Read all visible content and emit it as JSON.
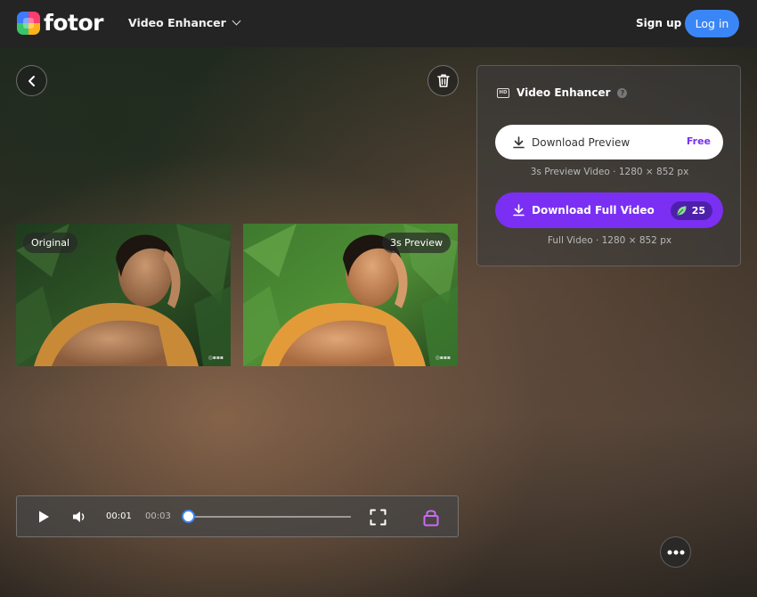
{
  "header": {
    "brand": "fotor",
    "nav_item": "Video Enhancer",
    "signup_label": "Sign up",
    "login_label": "Log in"
  },
  "previews": {
    "original_label": "Original",
    "enhanced_label": "3s Preview"
  },
  "panel": {
    "title": "Video Enhancer",
    "download_preview_label": "Download Preview",
    "free_label": "Free",
    "preview_caption": "3s Preview Video · 1280 × 852 px",
    "download_full_label": "Download Full Video",
    "credits": "25",
    "full_caption": "Full Video · 1280 × 852 px"
  },
  "player": {
    "current_time": "00:01",
    "duration": "00:03",
    "progress": 0.0
  },
  "colors": {
    "accent_blue": "#3b86f6",
    "accent_purple": "#7a2ff3",
    "header_bg": "#242424"
  },
  "icons": {
    "back": "chevron-left-icon",
    "delete": "trash-icon",
    "more": "more-icon",
    "play": "play-icon",
    "volume": "volume-icon",
    "fullscreen": "fullscreen-icon",
    "lock": "lock-icon",
    "download": "download-icon",
    "credit": "leaf-icon"
  }
}
